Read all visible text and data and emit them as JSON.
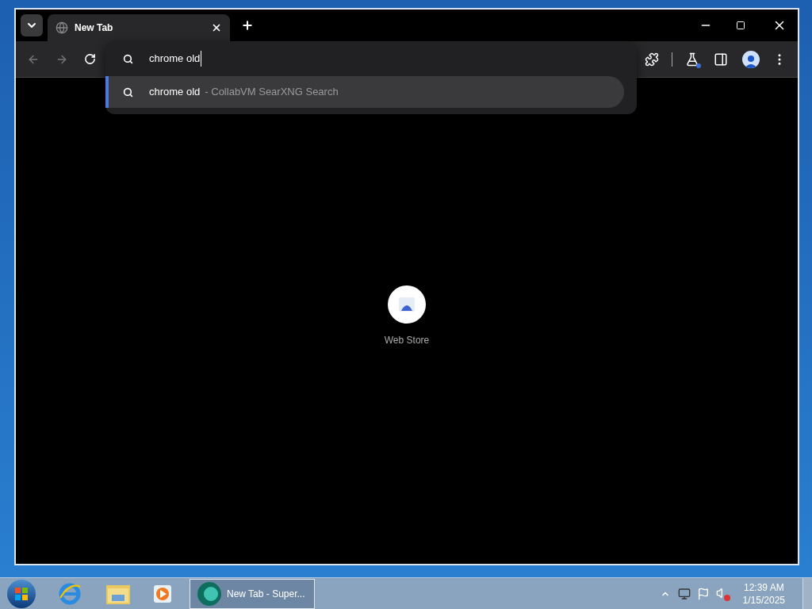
{
  "tabs": [
    {
      "title": "New Tab",
      "selected": true
    }
  ],
  "omnibox": {
    "value": "chrome old"
  },
  "suggestions": [
    {
      "query": "chrome old",
      "detail": "- CollabVM SearXNG Search",
      "selected": true
    }
  ],
  "shortcuts": [
    {
      "label": "Web Store"
    }
  ],
  "taskbar": {
    "windows": [
      {
        "label": "New Tab - Super...",
        "selected": true
      }
    ]
  },
  "clock": {
    "time": "12:39 AM",
    "date": "1/15/2025"
  }
}
